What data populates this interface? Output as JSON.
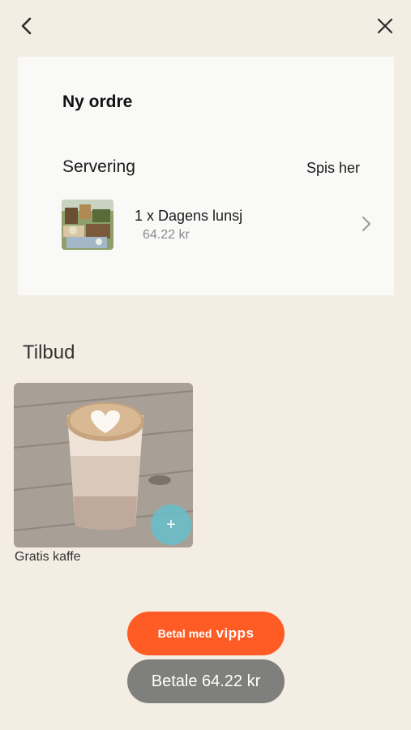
{
  "header": {
    "back_icon": "chevron-left-icon",
    "close_icon": "close-icon"
  },
  "order": {
    "title": "Ny ordre",
    "serving_label": "Servering",
    "serving_value": "Spis her",
    "items": [
      {
        "quantity_name": "1 x Dagens lunsj",
        "price": "64.22 kr"
      }
    ]
  },
  "offers": {
    "title": "Tilbud",
    "items": [
      {
        "label": "Gratis kaffe",
        "add_label": "+"
      }
    ]
  },
  "payment": {
    "vipps_label": "Betal med",
    "vipps_logo": "vipps",
    "pay_label": "Betale 64.22 kr"
  },
  "colors": {
    "background": "#f4ede3",
    "vipps": "#ff5b24",
    "pay_button": "#7f7f7d",
    "add_button": "#66becd"
  }
}
